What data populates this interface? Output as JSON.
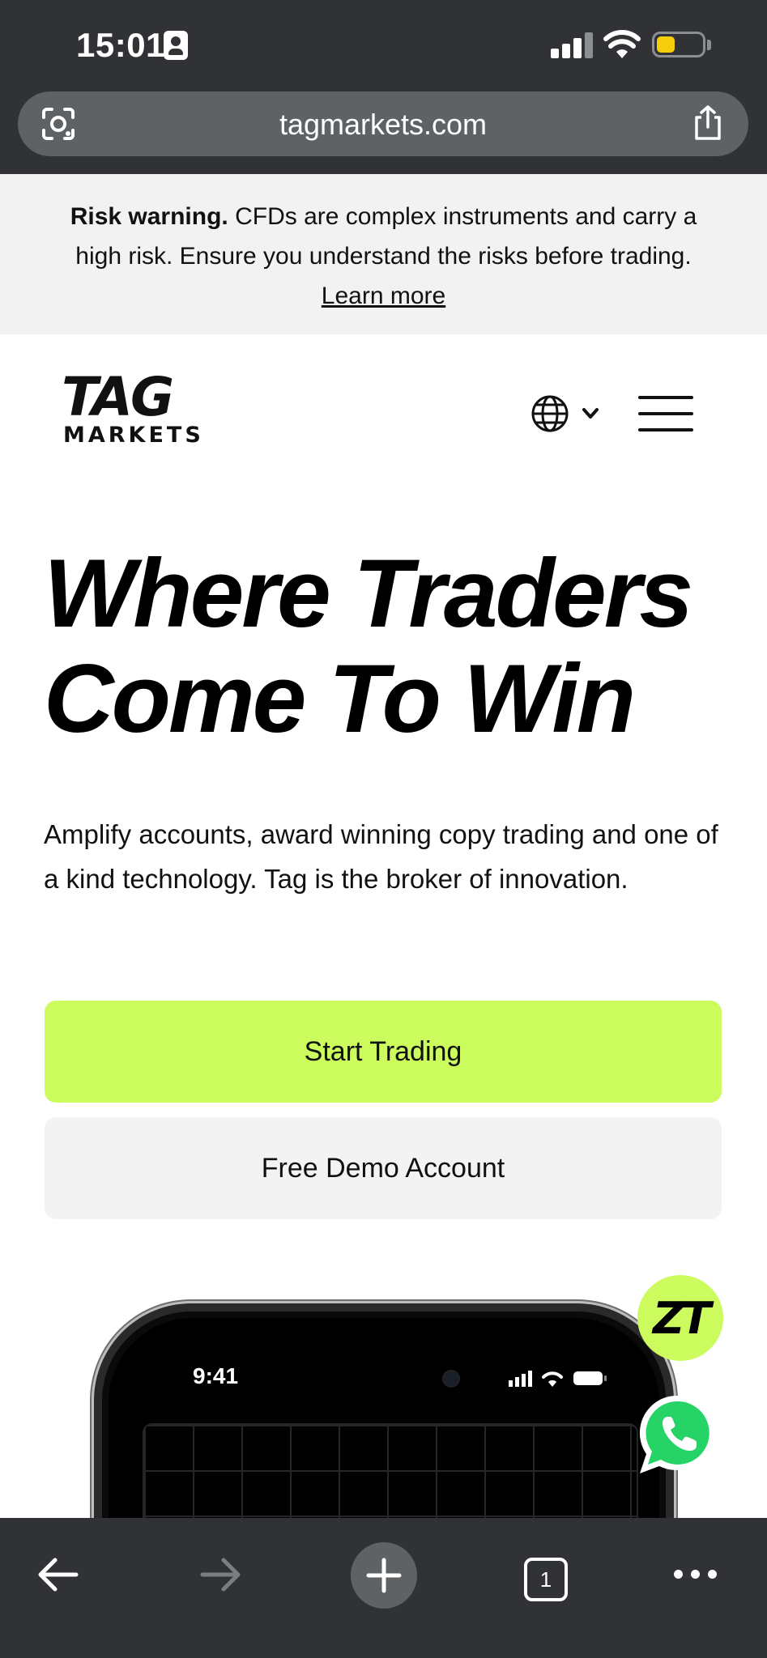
{
  "status_bar": {
    "time": "15:01"
  },
  "browser": {
    "url": "tagmarkets.com",
    "tab_count": "1"
  },
  "risk_banner": {
    "title": "Risk warning.",
    "text": " CFDs are complex instruments and carry a high risk. Ensure you understand the risks before trading. ",
    "link": "Learn more"
  },
  "header": {
    "logo_top": "TAG",
    "logo_bottom": "MARKETS"
  },
  "hero": {
    "title_line1": "Where Traders",
    "title_line2": "Come To Win",
    "subtitle": "Amplify accounts, award winning copy trading and one of a kind technology. Tag is the broker of innovation.",
    "primary_button": "Start Trading",
    "secondary_button": "Free Demo Account"
  },
  "phone_mockup": {
    "time": "9:41"
  },
  "fab": {
    "tag_label": "ZT"
  },
  "colors": {
    "accent": "#ccfb5e",
    "chrome": "#303236",
    "banner_bg": "#f2f2f2",
    "whatsapp": "#25d366"
  }
}
